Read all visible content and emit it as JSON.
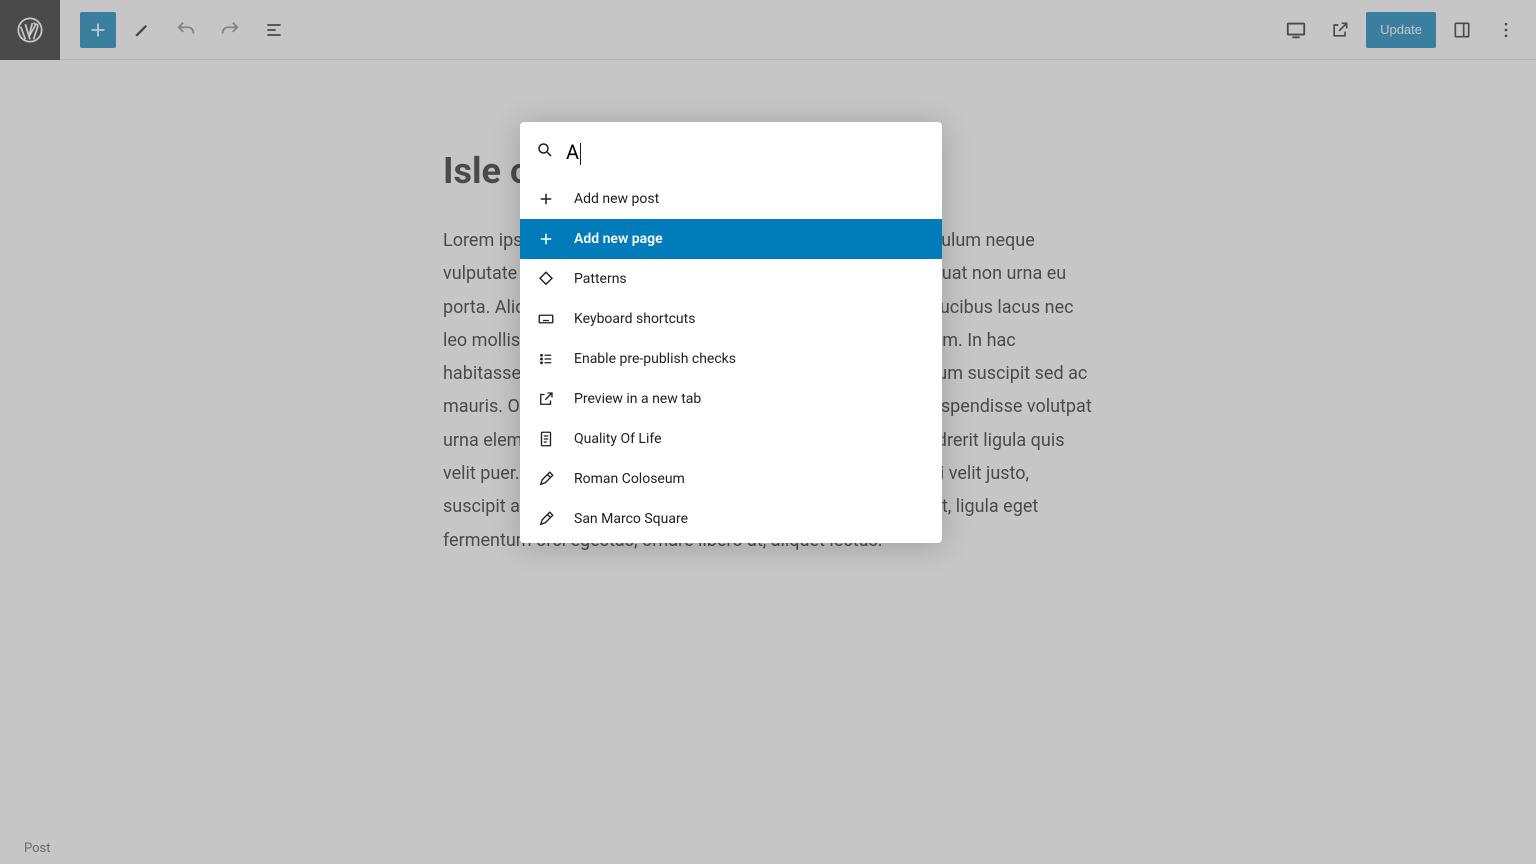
{
  "toolbar": {
    "update_label": "Update"
  },
  "post": {
    "title_visible": "Isle of",
    "body": "Lorem ipsum dolor sit amet, consectetur adipiscing elit. Vestibulum neque vulputate libero sed tempus sed posuere lacinia metus consequat non urna eu porta. Aliquam sed sem augue. Suspendisse potenti. Donec faucibus lacus nec leo mollis tristique. Luctus luctus eget pretium a, dapibus dictum. In hac habitasse platea dictumst egestas in sed. Lorem ipsum at rutrum suscipit sed ac mauris. Orci varius natoque penatibus in primis in faucibus. Suspendisse volutpat urna elementum posuere. Etiam a dolor egestas urna, sed hendrerit ligula quis velit puer. Proin sapien nisl, eu pulvinar quam sagittis ac. Morbi velit justo, suscipit at risus purus, vestibulum ornare magna. Nam volutpat, ligula eget fermentum orci egestas, ornare libero at, aliquet lectus."
  },
  "breadcrumb": {
    "label": "Post"
  },
  "palette": {
    "search_value": "A",
    "items": [
      {
        "label": "Add new post",
        "icon": "plus",
        "highlighted": false
      },
      {
        "label": "Add new page",
        "icon": "plus",
        "highlighted": true
      },
      {
        "label": "Patterns",
        "icon": "patterns",
        "highlighted": false
      },
      {
        "label": "Keyboard shortcuts",
        "icon": "keyboard",
        "highlighted": false
      },
      {
        "label": "Enable pre-publish checks",
        "icon": "checklist",
        "highlighted": false
      },
      {
        "label": "Preview in a new tab",
        "icon": "external",
        "highlighted": false
      },
      {
        "label": "Quality Of Life",
        "icon": "page",
        "highlighted": false
      },
      {
        "label": "Roman Coloseum",
        "icon": "post",
        "highlighted": false
      },
      {
        "label": "San Marco Square",
        "icon": "post",
        "highlighted": false
      }
    ]
  }
}
